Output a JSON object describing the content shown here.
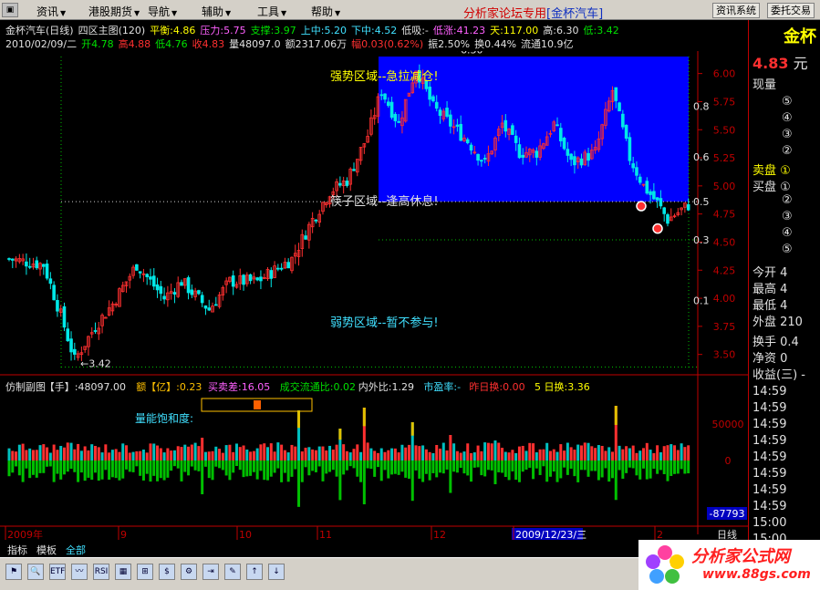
{
  "menu": {
    "items": [
      "资讯",
      "港股期货",
      "导航",
      "辅助",
      "工具",
      "帮助"
    ],
    "center_title_prefix": "分析家论坛专用",
    "center_title_symbol": "[金杯汽车]",
    "right_buttons": [
      "资讯系统",
      "委托交易"
    ]
  },
  "info": {
    "line1": [
      {
        "t": "金杯汽车(日线)",
        "c": "w"
      },
      {
        "t": "四区主图(120)",
        "c": "w"
      },
      {
        "t": "平衡:4.86",
        "c": "y"
      },
      {
        "t": "压力:5.75",
        "c": "m"
      },
      {
        "t": "支撑:3.97",
        "c": "g"
      },
      {
        "t": "上中:5.20",
        "c": "c"
      },
      {
        "t": "下中:4.52",
        "c": "c"
      },
      {
        "t": "低吸:-",
        "c": "w"
      },
      {
        "t": "低涨:41.23",
        "c": "m"
      },
      {
        "t": "天:117.00",
        "c": "y"
      },
      {
        "t": "高:6.30",
        "c": "w"
      },
      {
        "t": "低:3.42",
        "c": "g"
      }
    ],
    "line2": [
      {
        "t": "2010/02/09/二",
        "c": "w"
      },
      {
        "t": "开4.78",
        "c": "g"
      },
      {
        "t": "高4.88",
        "c": "rd"
      },
      {
        "t": "低4.76",
        "c": "g"
      },
      {
        "t": "收4.83",
        "c": "rd"
      },
      {
        "t": "量48097.0",
        "c": "w"
      },
      {
        "t": "额2317.06万",
        "c": "w"
      },
      {
        "t": "幅0.03(0.62%)",
        "c": "rd"
      },
      {
        "t": "振2.50%",
        "c": "w"
      },
      {
        "t": "换0.44%",
        "c": "w"
      },
      {
        "t": "流通10.9亿",
        "c": "w"
      }
    ]
  },
  "chart_data": {
    "type": "candlestick",
    "ylim": [
      3.4,
      6.2
    ],
    "y_ticks": [
      "6.00",
      "5.75",
      "5.50",
      "5.25",
      "5.00",
      "4.75",
      "4.50",
      "4.25",
      "4.00",
      "3.75",
      "3.50"
    ],
    "fib_labels": [
      "0.8",
      "0.6",
      "0.5",
      "0.3",
      "0.1"
    ],
    "annotations": {
      "strong": "强势区域--急拉减仓!",
      "chopsticks": "筷子区域--逢高休息!",
      "weak": "弱势区域--暂不参与!"
    },
    "high_label": "6.30",
    "low_label": "3.42",
    "high_value": 6.3,
    "low_value": 3.42,
    "x_month_labels": [
      "2009年",
      "9",
      "10",
      "11",
      "12",
      "2009/12/23/三",
      "2"
    ],
    "right_axis_label": "日线",
    "volume_panel": {
      "fields": [
        {
          "t": "仿制副图",
          "c": "w"
        },
        {
          "t": "【手】:48097.00",
          "c": "w"
        },
        {
          "t": "额【亿】:0.23",
          "c": "o"
        },
        {
          "t": "买卖差:16.05",
          "c": "m"
        },
        {
          "t": "成交流通比:0.02",
          "c": "g"
        },
        {
          "t": "内外比:1.29",
          "c": "w"
        },
        {
          "t": "市盈率:-",
          "c": "c"
        },
        {
          "t": "昨日换:0.00",
          "c": "rd"
        },
        {
          "t": "5 日换:3.36",
          "c": "y"
        }
      ],
      "saturation_label": "量能饱和度:",
      "y_ticks": [
        "50000",
        "0"
      ],
      "bottom_value": "-87793"
    }
  },
  "right_panel": {
    "title": "金杯",
    "price": "4.83",
    "price_unit": "元",
    "rows": [
      {
        "t": "现量",
        "c": "w"
      },
      {
        "t": "⑤",
        "c": "w",
        "ind": true
      },
      {
        "t": "④",
        "c": "w",
        "ind": true
      },
      {
        "t": "③",
        "c": "w",
        "ind": true
      },
      {
        "t": "②",
        "c": "w",
        "ind": true
      },
      {
        "t": "卖盘 ①",
        "c": "y"
      },
      {
        "t": "买盘 ①",
        "c": "w"
      },
      {
        "t": "②",
        "c": "w",
        "ind": true
      },
      {
        "t": "③",
        "c": "w",
        "ind": true
      },
      {
        "t": "④",
        "c": "w",
        "ind": true
      },
      {
        "t": "⑤",
        "c": "w",
        "ind": true
      },
      {
        "t": "今开  4",
        "c": "w"
      },
      {
        "t": "最高  4",
        "c": "w"
      },
      {
        "t": "最低  4",
        "c": "w"
      },
      {
        "t": "外盘  210",
        "c": "w"
      },
      {
        "t": "换手  0.4",
        "c": "w"
      },
      {
        "t": "净资  0",
        "c": "w"
      },
      {
        "t": "收益(三) -",
        "c": "w"
      },
      {
        "t": "14:59",
        "c": "w"
      },
      {
        "t": "14:59",
        "c": "w"
      },
      {
        "t": "14:59",
        "c": "w"
      },
      {
        "t": "14:59",
        "c": "w"
      },
      {
        "t": "14:59",
        "c": "w"
      },
      {
        "t": "14:59",
        "c": "w"
      },
      {
        "t": "14:59",
        "c": "w"
      },
      {
        "t": "14:59",
        "c": "w"
      },
      {
        "t": "15:00",
        "c": "w"
      },
      {
        "t": "15:00",
        "c": "w"
      }
    ]
  },
  "tabs": [
    "指标",
    "模板",
    "全部"
  ],
  "logo": {
    "line1": "分析家公式网",
    "line2": "www.88gs.com"
  },
  "colors": {
    "up": "#ff3030",
    "down": "#00e8e8",
    "zone": "#0000ff",
    "vol_pos_a": "#ff3030",
    "vol_pos_b": "#00c0c0",
    "vol_neg": "#00c000",
    "vol_hi": "#e0c000"
  }
}
